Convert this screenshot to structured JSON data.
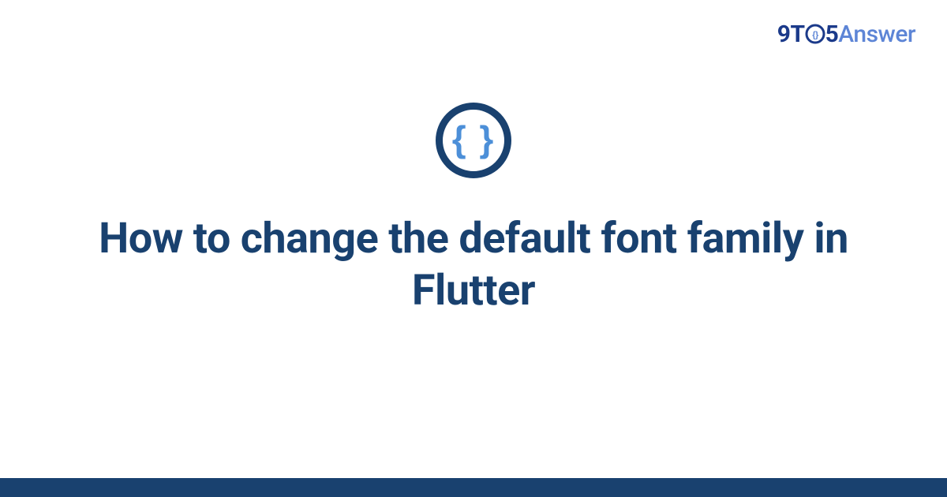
{
  "brand": {
    "prefix": "9T",
    "middle_digit": "5",
    "suffix": "Answer"
  },
  "icon": {
    "glyph": "{ }",
    "name": "code-braces-icon"
  },
  "main": {
    "title": "How to change the default font family in Flutter"
  },
  "colors": {
    "brand_dark": "#19416f",
    "brand_blue": "#1b3a8a",
    "brand_light": "#5d85d6",
    "brace_blue": "#4c8fd8"
  }
}
